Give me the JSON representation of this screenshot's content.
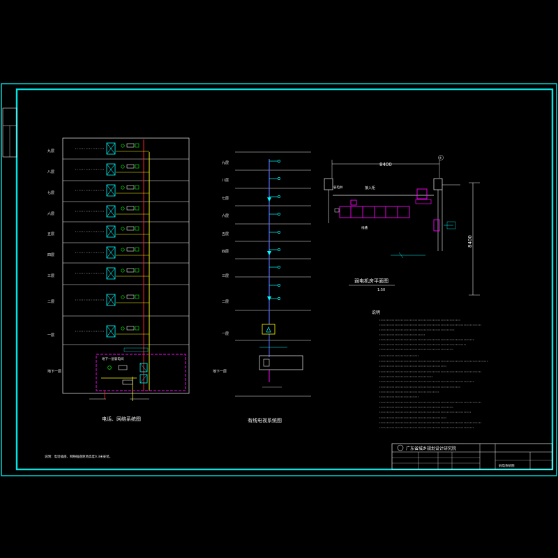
{
  "colors": {
    "frame": "#00e5e5",
    "line": "#f2f2f2",
    "magenta": "#ff00ff",
    "yellow": "#ffff00",
    "red": "#ff2020",
    "green": "#00ff00",
    "cyan": "#00ffff",
    "blue": "#5a6cff"
  },
  "left_diagram": {
    "title": "电话、网络系统图",
    "floors": [
      "九层",
      "八层",
      "七层",
      "六层",
      "五层",
      "四层",
      "三层",
      "二层",
      "一层",
      "地下一层"
    ],
    "basement_box_label": "地下一层弱电间",
    "note": "说明：电话插座、网络插座距地高度0.3米安装。"
  },
  "middle_diagram": {
    "title": "有线电视系统图",
    "floors": [
      "九层",
      "八层",
      "七层",
      "六层",
      "五层",
      "四层",
      "三层",
      "二层",
      "一层",
      "地下一层"
    ]
  },
  "plan": {
    "dimension_h": "8400",
    "dimension_v": "8400",
    "axis_label": "④",
    "room_left": "弱电井",
    "room_label": "接入柜",
    "tray_label": "线槽",
    "title": "弱电机房平面图",
    "scale": "1:50"
  },
  "notes": {
    "heading": "说明"
  },
  "title_block": {
    "institute": "广东省城乡规划设计研究院",
    "drawing_name": "弱电系统图"
  }
}
